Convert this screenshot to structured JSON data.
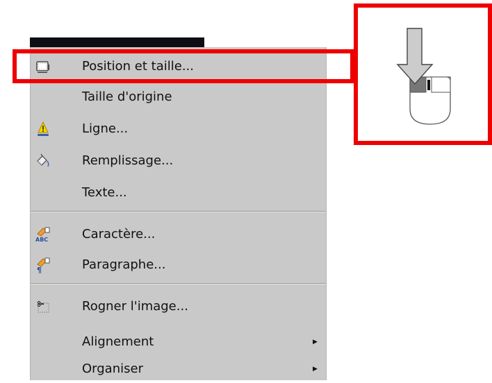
{
  "menu": {
    "items": [
      {
        "label": "Position et taille...",
        "icon": "position-size-icon"
      },
      {
        "label": "Taille d'origine",
        "icon": ""
      },
      {
        "label": "Ligne...",
        "icon": "line-icon"
      },
      {
        "label": "Remplissage...",
        "icon": "fill-bucket-icon"
      },
      {
        "label": "Texte...",
        "icon": ""
      },
      {
        "label": "Caractère...",
        "icon": "character-icon"
      },
      {
        "label": "Paragraphe...",
        "icon": "paragraph-icon"
      },
      {
        "label": "Rogner l'image...",
        "icon": "crop-icon"
      },
      {
        "label": "Alignement",
        "icon": "",
        "submenu": true
      },
      {
        "label": "Organiser",
        "icon": "",
        "submenu": true
      }
    ]
  },
  "annotations": {
    "highlight_color": "#ee0000",
    "mouse_icon": "mouse-left-click-icon"
  }
}
